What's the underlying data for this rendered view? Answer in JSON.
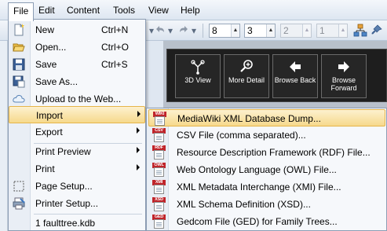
{
  "menubar": {
    "items": [
      "File",
      "Edit",
      "Content",
      "Tools",
      "View",
      "Help"
    ]
  },
  "toolbar": {
    "spinners": [
      {
        "value": "8",
        "enabled": true
      },
      {
        "value": "3",
        "enabled": true
      },
      {
        "value": "2",
        "enabled": false
      },
      {
        "value": "1",
        "enabled": false
      }
    ]
  },
  "nav_buttons": [
    {
      "label": "3D View",
      "icon": "3d-view-icon"
    },
    {
      "label": "More Detail",
      "icon": "magnifier-plus-icon"
    },
    {
      "label": "Browse Back",
      "icon": "arrow-left-icon"
    },
    {
      "label": "Browse Forward",
      "icon": "arrow-right-icon"
    }
  ],
  "file_menu": {
    "items": [
      {
        "label": "New",
        "shortcut": "Ctrl+N",
        "icon": "new-document-icon"
      },
      {
        "label": "Open...",
        "shortcut": "Ctrl+O",
        "icon": "open-folder-icon"
      },
      {
        "label": "Save",
        "shortcut": "Ctrl+S",
        "icon": "floppy-disk-icon"
      },
      {
        "label": "Save As...",
        "shortcut": "",
        "icon": "save-as-icon"
      },
      {
        "label": "Upload to the Web...",
        "shortcut": "",
        "icon": "cloud-icon"
      },
      {
        "label": "Import",
        "shortcut": "",
        "submenu": true,
        "highlighted": true
      },
      {
        "label": "Export",
        "shortcut": "",
        "submenu": true
      },
      {
        "label": "Print Preview",
        "shortcut": "",
        "submenu": true
      },
      {
        "label": "Print",
        "shortcut": "",
        "submenu": true
      },
      {
        "label": "Page Setup...",
        "shortcut": "",
        "icon": "page-setup-icon"
      },
      {
        "label": "Printer Setup...",
        "shortcut": "",
        "icon": "printer-setup-icon"
      },
      {
        "label": "1 faulttree.kdb",
        "shortcut": ""
      }
    ]
  },
  "import_menu": {
    "items": [
      {
        "label": "MediaWiki XML Database Dump...",
        "badge": "WIKI",
        "highlighted": true
      },
      {
        "label": "CSV File (comma separated)...",
        "badge": "CSV"
      },
      {
        "label": "Resource Description Framework (RDF) File...",
        "badge": "RDF"
      },
      {
        "label": "Web Ontology Language (OWL) File...",
        "badge": "OWL"
      },
      {
        "label": "XML Metadata Interchange (XMI) File...",
        "badge": "XMI"
      },
      {
        "label": "XML Schema Definition (XSD)...",
        "badge": "XSD"
      },
      {
        "label": "Gedcom File (GED) for Family Trees...",
        "badge": "GED"
      }
    ]
  },
  "colors": {
    "highlight": "#f6d98c",
    "badge_red": "#c0252b",
    "graph_dark": "#1e1e1e"
  }
}
